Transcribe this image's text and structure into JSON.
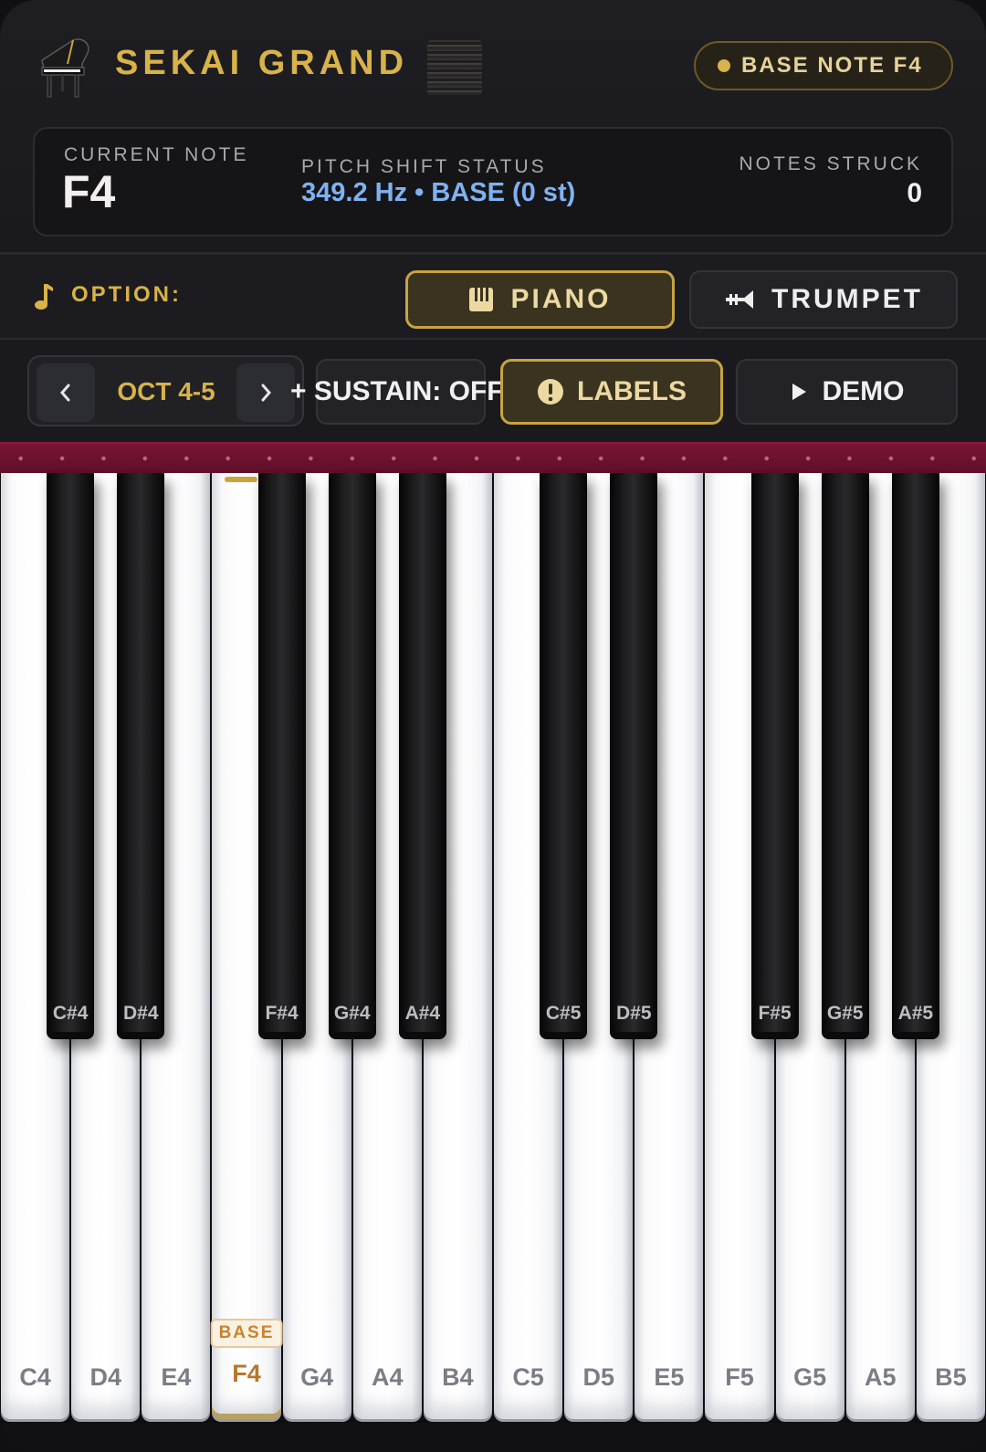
{
  "header": {
    "title": "SEKAI GRAND",
    "base_pill": "BASE NOTE F4"
  },
  "status": {
    "current_note_label": "CURRENT NOTE",
    "current_note_value": "F4",
    "pitch_label": "PITCH SHIFT STATUS",
    "pitch_value": "349.2 Hz • BASE (0 st)",
    "struck_label": "NOTES STRUCK",
    "struck_value": "0"
  },
  "options": {
    "label": "OPTION:",
    "piano": "PIANO",
    "trumpet": "TRUMPET",
    "selected": "PIANO"
  },
  "controls": {
    "octave_prev": "‹",
    "octave_label": "OCT 4-5",
    "octave_next": "›",
    "sustain": "+ SUSTAIN: OFF",
    "labels": "LABELS",
    "demo": "DEMO"
  },
  "keyboard": {
    "white_keys": [
      "C4",
      "D4",
      "E4",
      "F4",
      "G4",
      "A4",
      "B4",
      "C5",
      "D5",
      "E5",
      "F5",
      "G5",
      "A5",
      "B5"
    ],
    "black_keys": [
      "C#4",
      "D#4",
      "F#4",
      "G#4",
      "A#4",
      "C#5",
      "D#5",
      "F#5",
      "G#5",
      "A#5"
    ],
    "base_key": "F4",
    "base_tag": "BASE"
  },
  "colors": {
    "accent_gold": "#d8b24a",
    "pitch_blue": "#7fb2f0",
    "felt_red": "#7a1434"
  }
}
